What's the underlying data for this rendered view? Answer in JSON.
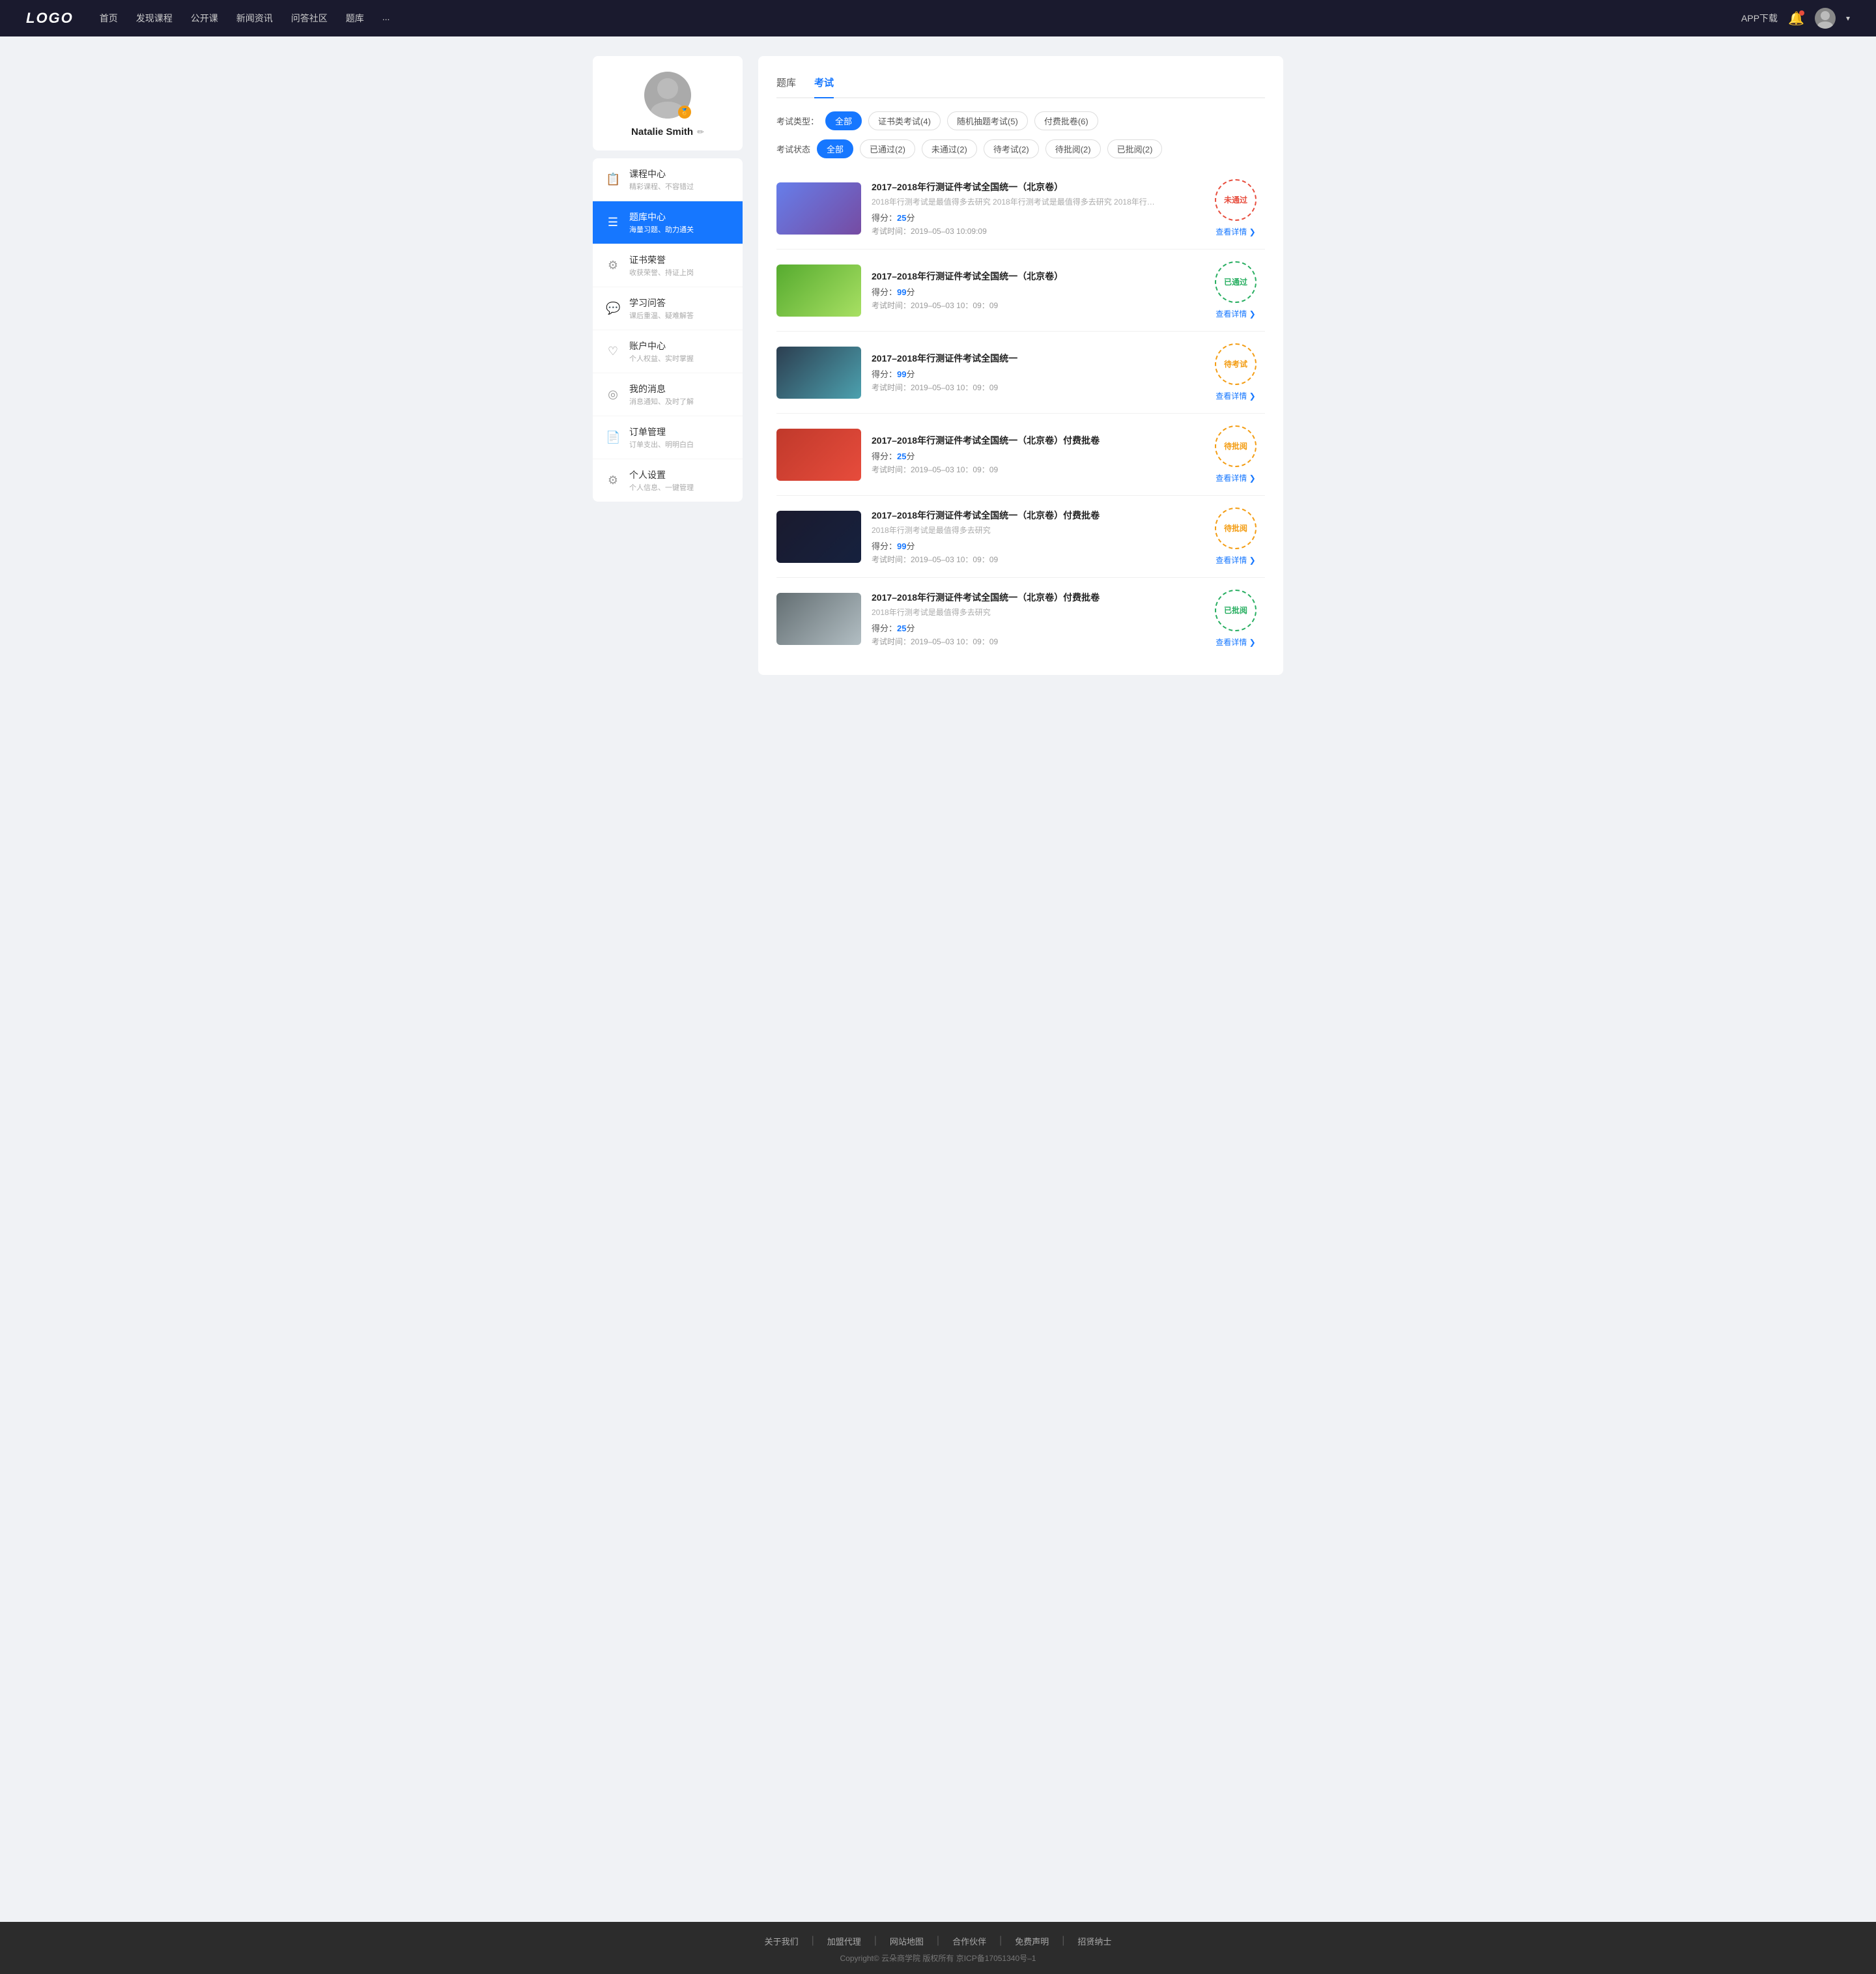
{
  "navbar": {
    "logo": "LOGO",
    "links": [
      "首页",
      "发现课程",
      "公开课",
      "新闻资讯",
      "问答社区",
      "题库",
      "..."
    ],
    "app_btn": "APP下载",
    "user_chevron": "▾"
  },
  "sidebar": {
    "profile": {
      "name": "Natalie Smith",
      "edit_tooltip": "编辑"
    },
    "menu": [
      {
        "id": "course",
        "icon": "📋",
        "text": "课程中心",
        "sub": "精彩课程、不容错过"
      },
      {
        "id": "question",
        "icon": "☰",
        "text": "题库中心",
        "sub": "海量习题、助力通关",
        "active": true
      },
      {
        "id": "honor",
        "icon": "⚙",
        "text": "证书荣誉",
        "sub": "收获荣誉、持证上岗"
      },
      {
        "id": "qa",
        "icon": "💬",
        "text": "学习问答",
        "sub": "课后重温、疑难解答"
      },
      {
        "id": "account",
        "icon": "♡",
        "text": "账户中心",
        "sub": "个人权益、实时掌握"
      },
      {
        "id": "message",
        "icon": "◎",
        "text": "我的消息",
        "sub": "消息通知、及时了解"
      },
      {
        "id": "order",
        "icon": "📄",
        "text": "订单管理",
        "sub": "订单支出、明明白白"
      },
      {
        "id": "settings",
        "icon": "⚙",
        "text": "个人设置",
        "sub": "个人信息、一键管理"
      }
    ]
  },
  "main": {
    "top_tabs": [
      {
        "id": "bank",
        "label": "题库"
      },
      {
        "id": "exam",
        "label": "考试",
        "active": true
      }
    ],
    "filter_type": {
      "label": "考试类型：",
      "options": [
        {
          "id": "all",
          "label": "全部",
          "active": true
        },
        {
          "id": "cert",
          "label": "证书类考试(4)"
        },
        {
          "id": "random",
          "label": "随机抽题考试(5)"
        },
        {
          "id": "paid",
          "label": "付费批卷(6)"
        }
      ]
    },
    "filter_status": {
      "label": "考试状态",
      "options": [
        {
          "id": "all",
          "label": "全部",
          "active": true
        },
        {
          "id": "passed",
          "label": "已通过(2)"
        },
        {
          "id": "failed",
          "label": "未通过(2)"
        },
        {
          "id": "pending",
          "label": "待考试(2)"
        },
        {
          "id": "review",
          "label": "待批阅(2)"
        },
        {
          "id": "reviewed",
          "label": "已批阅(2)"
        }
      ]
    },
    "exams": [
      {
        "id": 1,
        "thumb_class": "thumb-1",
        "title": "2017–2018年行测证件考试全国统一（北京卷）",
        "desc": "2018年行测考试是最值得多去研究 2018年行测考试是最值得多去研究 2018年行…",
        "score_label": "得分：",
        "score": "25",
        "score_suffix": "分",
        "time_label": "考试时间：",
        "time": "2019–05–03  10:09:09",
        "status_text": "未通过",
        "status_class": "stamp-fail",
        "detail_label": "查看详情"
      },
      {
        "id": 2,
        "thumb_class": "thumb-2",
        "title": "2017–2018年行测证件考试全国统一（北京卷）",
        "desc": "",
        "score_label": "得分：",
        "score": "99",
        "score_suffix": "分",
        "time_label": "考试时间：",
        "time": "2019–05–03  10：09：09",
        "status_text": "已通过",
        "status_class": "stamp-pass",
        "detail_label": "查看详情"
      },
      {
        "id": 3,
        "thumb_class": "thumb-3",
        "title": "2017–2018年行测证件考试全国统一",
        "desc": "",
        "score_label": "得分：",
        "score": "99",
        "score_suffix": "分",
        "time_label": "考试时间：",
        "time": "2019–05–03  10：09：09",
        "status_text": "待考试",
        "status_class": "stamp-pending",
        "detail_label": "查看详情"
      },
      {
        "id": 4,
        "thumb_class": "thumb-4",
        "title": "2017–2018年行测证件考试全国统一（北京卷）付费批卷",
        "desc": "",
        "score_label": "得分：",
        "score": "25",
        "score_suffix": "分",
        "time_label": "考试时间：",
        "time": "2019–05–03  10：09：09",
        "status_text": "待批阅",
        "status_class": "stamp-review",
        "detail_label": "查看详情"
      },
      {
        "id": 5,
        "thumb_class": "thumb-5",
        "title": "2017–2018年行测证件考试全国统一（北京卷）付费批卷",
        "desc": "2018年行测考试是最值得多去研究",
        "score_label": "得分：",
        "score": "99",
        "score_suffix": "分",
        "time_label": "考试时间：",
        "time": "2019–05–03  10：09：09",
        "status_text": "待批阅",
        "status_class": "stamp-review",
        "detail_label": "查看详情"
      },
      {
        "id": 6,
        "thumb_class": "thumb-6",
        "title": "2017–2018年行测证件考试全国统一（北京卷）付费批卷",
        "desc": "2018年行测考试是最值得多去研究",
        "score_label": "得分：",
        "score": "25",
        "score_suffix": "分",
        "time_label": "考试时间：",
        "time": "2019–05–03  10：09：09",
        "status_text": "已批阅",
        "status_class": "stamp-reviewed",
        "detail_label": "查看详情"
      }
    ]
  },
  "footer": {
    "links": [
      "关于我们",
      "加盟代理",
      "网站地图",
      "合作伙伴",
      "免费声明",
      "招贤纳士"
    ],
    "copyright": "Copyright© 云朵商学院  版权所有    京ICP备17051340号–1"
  }
}
